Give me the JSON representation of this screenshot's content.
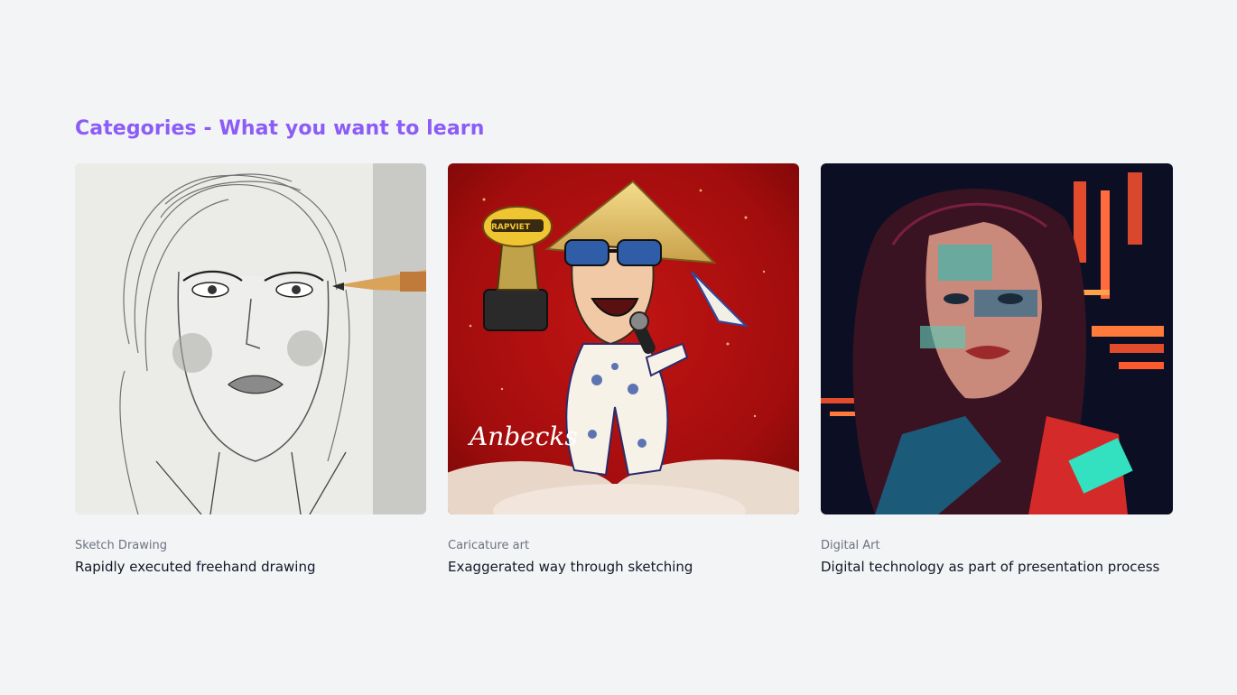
{
  "section": {
    "title": "Categories - What you want to learn"
  },
  "cards": [
    {
      "category": "Sketch Drawing",
      "description": "Rapidly executed freehand drawing",
      "image_icon": "pencil-sketch-portrait-image"
    },
    {
      "category": "Caricature art",
      "description": "Exaggerated way through sketching",
      "image_icon": "caricature-illustration-image",
      "signature": "Anbecks",
      "badge": "RAPVIET"
    },
    {
      "category": "Digital Art",
      "description": "Digital technology as part of presentation process",
      "image_icon": "digital-glitch-portrait-image"
    }
  ],
  "colors": {
    "background": "#f3f4f6",
    "accent": "#8b5cf6",
    "muted": "#6b7280",
    "text": "#111827"
  }
}
